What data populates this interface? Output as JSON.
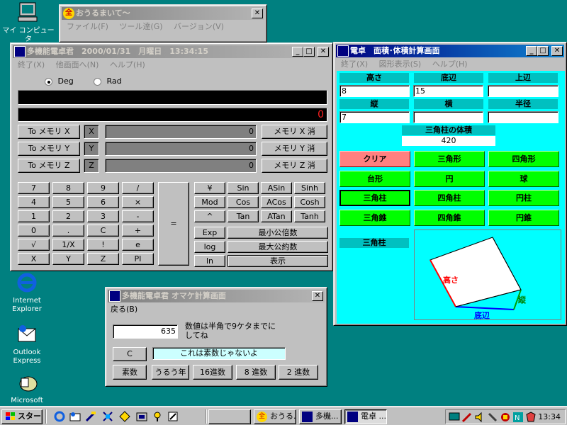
{
  "desktop": {
    "icons": [
      {
        "label": "マイ コンピュータ"
      },
      {
        "label": "Internet Explorer"
      },
      {
        "label": "Outlook Express"
      },
      {
        "label": "Microsoft"
      }
    ]
  },
  "omake_bg": {
    "title": "おうるまいて～",
    "menu": [
      "ファイル(F)",
      "ツール達(G)",
      "バージョン(V)"
    ]
  },
  "calc": {
    "title": "多機能電卓君　2000/01/31　月曜日　13:34:15",
    "menu": [
      "終了(X)",
      "他画面へ(N)",
      "ヘルプ(H)"
    ],
    "deg": "Deg",
    "rad": "Rad",
    "display": "0",
    "memory": [
      {
        "to": "To メモリ X",
        "name": "X",
        "value": "0",
        "clear": "メモリ X 消"
      },
      {
        "to": "To メモリ Y",
        "name": "Y",
        "value": "0",
        "clear": "メモリ Y 消"
      },
      {
        "to": "To メモリ Z",
        "name": "Z",
        "value": "0",
        "clear": "メモリ Z 消"
      }
    ],
    "keys": [
      [
        "7",
        "8",
        "9",
        "/"
      ],
      [
        "4",
        "5",
        "6",
        "×"
      ],
      [
        "1",
        "2",
        "3",
        "-"
      ],
      [
        "0",
        ".",
        "C",
        "+"
      ],
      [
        "√",
        "1/X",
        "!",
        "e"
      ],
      [
        "X",
        "Y",
        "Z",
        "PI"
      ]
    ],
    "equals": "=",
    "func": [
      [
        "¥",
        "Sin",
        "ASin",
        "Sinh"
      ],
      [
        "Mod",
        "Cos",
        "ACos",
        "Cosh"
      ],
      [
        "^",
        "Tan",
        "ATan",
        "Tanh"
      ]
    ],
    "exp": "Exp",
    "lcm": "最小公倍数",
    "log": "log",
    "gcd": "最大公約数",
    "ln": "ln",
    "show": "表示"
  },
  "area": {
    "title": "電卓　面積･体積計算画面",
    "menu": [
      "終了(X)",
      "図形表示(S)",
      "ヘルプ(H)"
    ],
    "labels": [
      "高さ",
      "底辺",
      "上辺",
      "縦",
      "横",
      "半径"
    ],
    "values": [
      "8",
      "15",
      "",
      "7",
      "",
      ""
    ],
    "result_label": "三角柱の体積",
    "result": "420",
    "clear": "クリア",
    "shapes": [
      "三角形",
      "四角形",
      "台形",
      "円",
      "球",
      "三角柱",
      "四角柱",
      "円柱",
      "三角錐",
      "四角錐",
      "円錐"
    ],
    "current": "三角柱",
    "fig_height": "高さ",
    "fig_depth": "縦",
    "fig_base": "底辺"
  },
  "omake": {
    "title": "多機能電卓君 オマケ計算画面",
    "menu": [
      "戻る(B)"
    ],
    "input": "635",
    "hint": "数値は半角で9ケタまでにしてね",
    "c": "C",
    "message": "これは素数じゃないよ",
    "buttons": [
      "素数",
      "うるう年",
      "16進数",
      "8 進数",
      "2 進数"
    ]
  },
  "taskbar": {
    "start": "スタート",
    "tasks": [
      "",
      "おうる...",
      "多機...",
      "電卓 ..."
    ],
    "clock": "13:34"
  }
}
